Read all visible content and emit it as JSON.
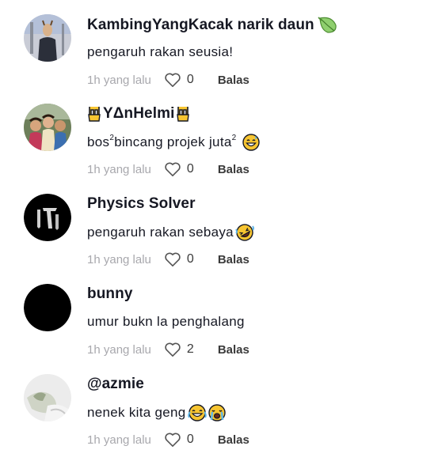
{
  "comments": [
    {
      "username": "KambingYangKacak narik daun",
      "username_icon": "leaf-emoji",
      "text": "pengaruh rakan seusia!",
      "time": "1h yang lalu",
      "likes": "0",
      "reply_label": "Balas"
    },
    {
      "username": "YΔnHelmi",
      "username_icon": "rock-hand-emoji",
      "text_parts": [
        "bos",
        "2",
        " bincang projek juta",
        "2"
      ],
      "text_icon": "grinning-sweat-emoji",
      "time": "1h yang lalu",
      "likes": "0",
      "reply_label": "Balas"
    },
    {
      "username": "Physics Solver",
      "text": "pengaruh rakan sebaya",
      "text_icon": "rolling-laughing-emoji",
      "time": "1h yang lalu",
      "likes": "0",
      "reply_label": "Balas"
    },
    {
      "username": "bunny",
      "text": "umur bukn la penghalang",
      "time": "1h yang lalu",
      "likes": "2",
      "reply_label": "Balas"
    },
    {
      "username": "@azmie",
      "text": "nenek kita geng",
      "text_icons": [
        "joy-emoji",
        "crying-emoji"
      ],
      "time": "1h yang lalu",
      "likes": "0",
      "reply_label": "Balas"
    }
  ],
  "colors": {
    "meta_text": "#a8a8ad",
    "emoji_yellow": "#f7c531",
    "leaf_green": "#8fcf6e"
  }
}
